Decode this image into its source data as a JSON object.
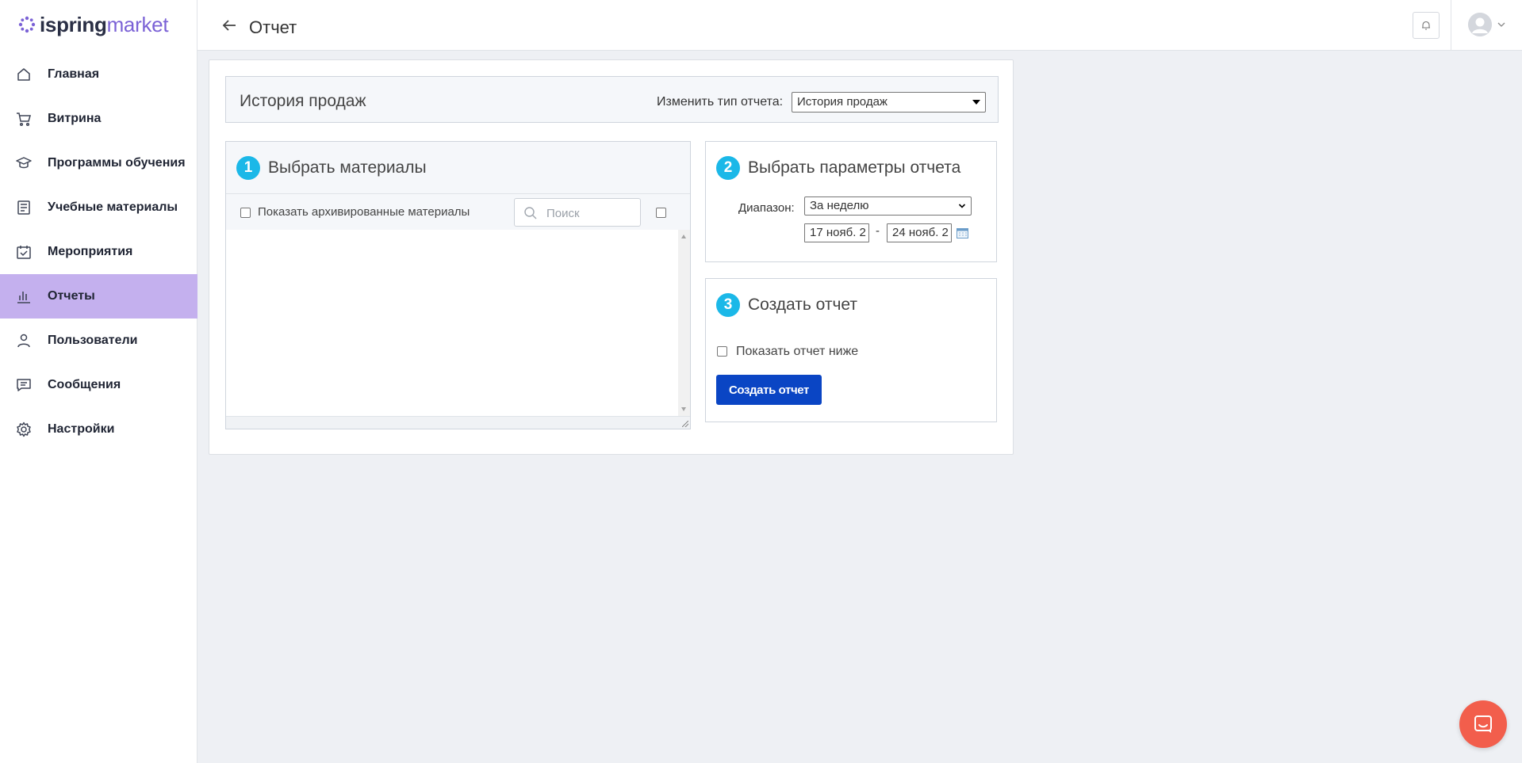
{
  "brand": {
    "part1": "ispring",
    "part2": "market",
    "accent": "#7b62d6"
  },
  "sidebar": {
    "items": [
      {
        "label": "Главная",
        "icon": "home-icon",
        "active": false
      },
      {
        "label": "Витрина",
        "icon": "cart-icon",
        "active": false
      },
      {
        "label": "Программы обучения",
        "icon": "graduation-cap-icon",
        "active": false
      },
      {
        "label": "Учебные материалы",
        "icon": "document-icon",
        "active": false
      },
      {
        "label": "Мероприятия",
        "icon": "calendar-check-icon",
        "active": false
      },
      {
        "label": "Отчеты",
        "icon": "bar-chart-icon",
        "active": true
      },
      {
        "label": "Пользователи",
        "icon": "user-icon",
        "active": false
      },
      {
        "label": "Сообщения",
        "icon": "message-icon",
        "active": false
      },
      {
        "label": "Настройки",
        "icon": "gear-icon",
        "active": false
      }
    ],
    "active_color": "#c4b0ee"
  },
  "header": {
    "title": "Отчет"
  },
  "report": {
    "title": "История продаж",
    "change_type_label": "Изменить тип отчета:",
    "type_value": "История продаж"
  },
  "step1": {
    "number": "1",
    "title": "Выбрать материалы",
    "show_archived_label": "Показать архивированные материалы",
    "search_placeholder": "Поиск"
  },
  "step2": {
    "number": "2",
    "title": "Выбрать параметры отчета",
    "range_label": "Диапазон:",
    "range_value": "За неделю",
    "date_from": "17 нояб. 2",
    "date_sep": "-",
    "date_to": "24 нояб. 2"
  },
  "step3": {
    "number": "3",
    "title": "Создать отчет",
    "show_below_label": "Показать отчет ниже",
    "create_button": "Создать отчет"
  },
  "colors": {
    "step_circle": "#1bb8e8",
    "primary_button": "#0a45c4",
    "chat_button": "#f25e4c"
  }
}
